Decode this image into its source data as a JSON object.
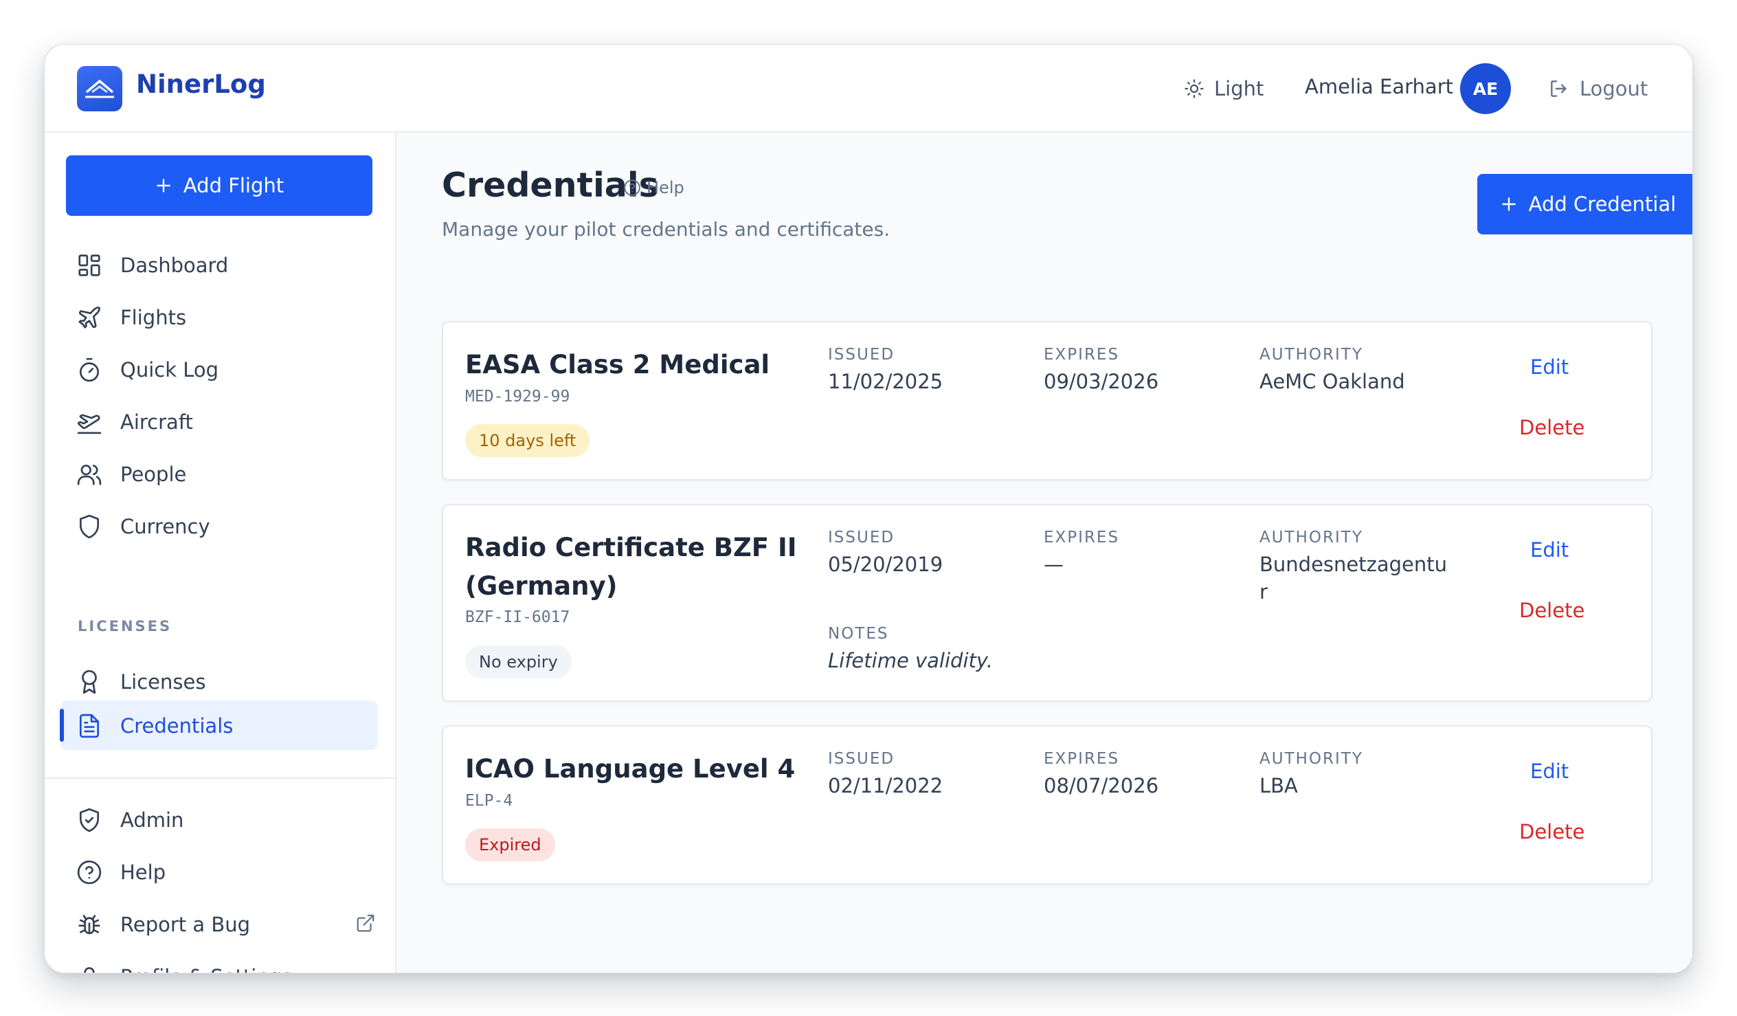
{
  "header": {
    "brand": "NinerLog",
    "theme_label": "Light",
    "user_name": "Amelia Earhart",
    "user_initials": "AE",
    "logout_label": "Logout"
  },
  "sidebar": {
    "add_flight_label": "Add Flight",
    "items": [
      {
        "label": "Dashboard",
        "icon": "dashboard-icon"
      },
      {
        "label": "Flights",
        "icon": "plane-icon"
      },
      {
        "label": "Quick Log",
        "icon": "stopwatch-icon"
      },
      {
        "label": "Aircraft",
        "icon": "plane-takeoff-icon"
      },
      {
        "label": "People",
        "icon": "users-icon"
      },
      {
        "label": "Currency",
        "icon": "shield-icon"
      }
    ],
    "section_label": "LICENSES",
    "license_items": [
      {
        "label": "Licenses",
        "icon": "award-icon"
      },
      {
        "label": "Credentials",
        "icon": "document-icon",
        "active": true
      }
    ],
    "bottom_items": [
      {
        "label": "Admin",
        "icon": "shield-check-icon"
      },
      {
        "label": "Help",
        "icon": "help-circle-icon"
      },
      {
        "label": "Report a Bug",
        "icon": "bug-icon",
        "external": true
      },
      {
        "label": "Profile & Settings",
        "icon": "user-icon"
      }
    ]
  },
  "main": {
    "title": "Credentials",
    "help_label": "Help",
    "subtitle": "Manage your pilot credentials and certificates.",
    "add_credential_label": "Add Credential",
    "labels": {
      "issued": "ISSUED",
      "expires": "EXPIRES",
      "authority": "AUTHORITY",
      "notes": "NOTES",
      "edit": "Edit",
      "delete": "Delete"
    },
    "credentials": [
      {
        "title": "EASA Class 2 Medical",
        "code": "MED-1929-99",
        "badge": "10 days left",
        "badge_type": "warning",
        "issued": "11/02/2025",
        "expires": "09/03/2026",
        "authority": "AeMC Oakland"
      },
      {
        "title": "Radio Certificate BZF II (Germany)",
        "code": "BZF-II-6017",
        "badge": "No expiry",
        "badge_type": "neutral",
        "issued": "05/20/2019",
        "expires": "—",
        "authority": "Bundesnetzagentur",
        "notes": "Lifetime validity."
      },
      {
        "title": "ICAO Language Level 4",
        "code": "ELP-4",
        "badge": "Expired",
        "badge_type": "expired",
        "issued": "02/11/2022",
        "expires": "08/07/2026",
        "authority": "LBA"
      }
    ]
  },
  "colors": {
    "primary": "#1d5cf5",
    "brand_text": "#1e40af",
    "danger": "#dc2626",
    "warning_bg": "#fdf2c7",
    "expired_bg": "#fde2e2"
  }
}
